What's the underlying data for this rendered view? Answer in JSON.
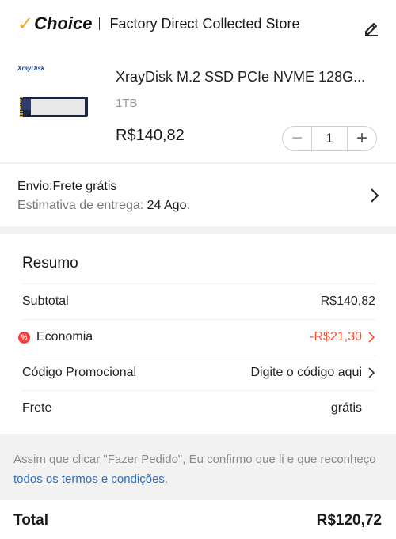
{
  "store": {
    "choice_label": "Choice",
    "name": "Factory Direct Collected Store"
  },
  "product": {
    "brand": "XrayDisk",
    "title": "XrayDisk M.2 SSD PCIe NVME 128G...",
    "variant": "1TB",
    "price": "R$140,82",
    "quantity": "1",
    "minus": "−",
    "plus": "+"
  },
  "shipping": {
    "title": "Envio:Frete grátis",
    "estimate_label": "Estimativa de entrega: ",
    "estimate_date": "24 Ago."
  },
  "summary": {
    "title": "Resumo",
    "subtotal_label": "Subtotal",
    "subtotal_value": "R$140,82",
    "economy_label": "Economia",
    "economy_badge": "%",
    "economy_value": "-R$21,30",
    "promo_label": "Código Promocional",
    "promo_value": "Digite o código aqui",
    "freight_label": "Frete",
    "freight_value": "grátis"
  },
  "notice": {
    "text": "Assim que clicar \"Fazer Pedido\", Eu confirmo que li e que reconheço ",
    "link": "todos os termos e condições",
    "end": "."
  },
  "total": {
    "label": "Total",
    "value": "R$120,72"
  },
  "colors": {
    "accent_red": "#ff4d2a",
    "choice_orange": "#f6a823",
    "link_blue": "#2d6fbf"
  }
}
